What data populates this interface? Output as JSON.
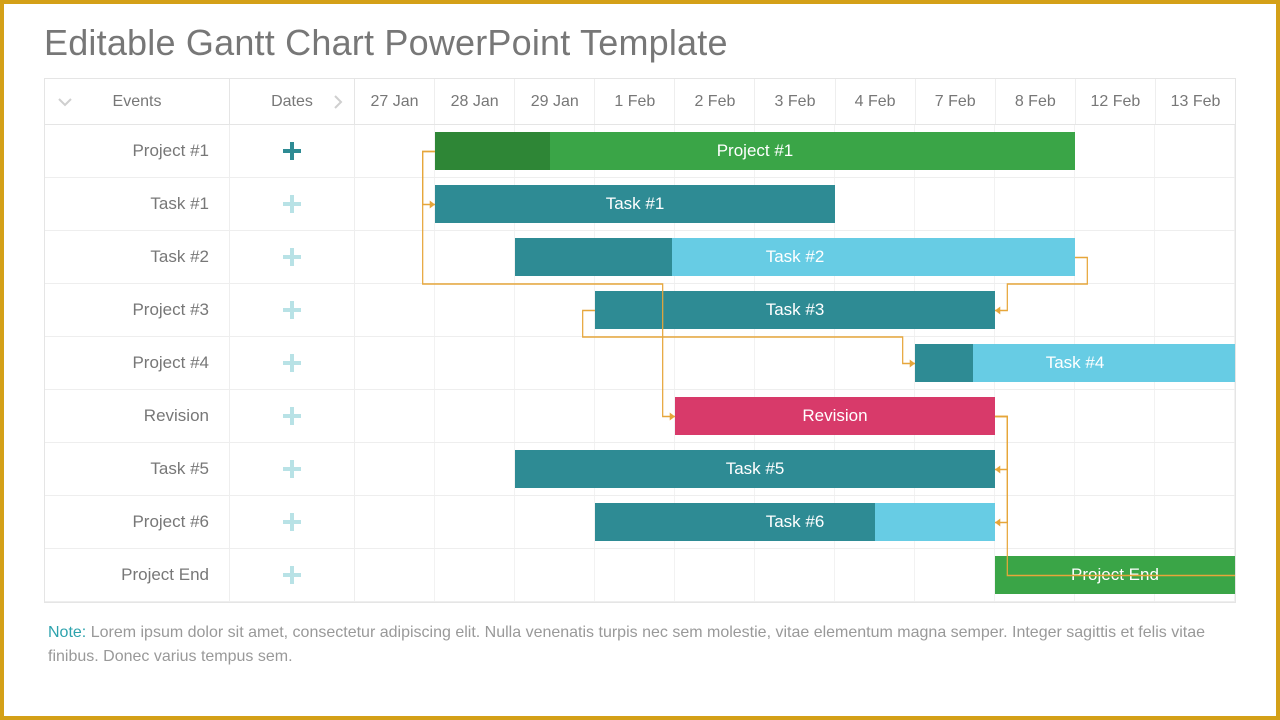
{
  "title": "Editable Gantt Chart PowerPoint Template",
  "header": {
    "events_label": "Events",
    "dates_label": "Dates",
    "dates": [
      "27 Jan",
      "28 Jan",
      "29 Jan",
      "1 Feb",
      "2 Feb",
      "3 Feb",
      "4 Feb",
      "7 Feb",
      "8 Feb",
      "12 Feb",
      "13 Feb"
    ]
  },
  "rows": [
    {
      "event": "Project #1",
      "plus": "teal",
      "bar": {
        "label": "Project #1",
        "start": 1,
        "span": 8,
        "fill": "#3aa547",
        "progFill": "#2e8636",
        "progPct": 0.18
      }
    },
    {
      "event": "Task #1",
      "plus": "light",
      "bar": {
        "label": "Task #1",
        "start": 1,
        "span": 5,
        "fill": "#2e8b94"
      }
    },
    {
      "event": "Task #2",
      "plus": "light",
      "bar": {
        "label": "Task #2",
        "start": 2,
        "span": 7,
        "fill": "#67cce4",
        "progFill": "#2e8b94",
        "progPct": 0.28
      }
    },
    {
      "event": "Project #3",
      "plus": "light",
      "bar": {
        "label": "Task #3",
        "start": 3,
        "span": 5,
        "fill": "#2e8b94"
      }
    },
    {
      "event": "Project #4",
      "plus": "light",
      "bar": {
        "label": "Task #4",
        "start": 7,
        "span": 4,
        "fill": "#67cce4",
        "progFill": "#2e8b94",
        "progPct": 0.18
      }
    },
    {
      "event": "Revision",
      "plus": "light",
      "bar": {
        "label": "Revision",
        "start": 4,
        "span": 4,
        "fill": "#d83a6a"
      }
    },
    {
      "event": "Task #5",
      "plus": "light",
      "bar": {
        "label": "Task #5",
        "start": 2,
        "span": 6,
        "fill": "#2e8b94"
      }
    },
    {
      "event": "Project #6",
      "plus": "light",
      "bar": {
        "label": "Task #6",
        "start": 3,
        "span": 5,
        "fill": "#67cce4",
        "progFill": "#2e8b94",
        "progPct": 0.7
      }
    },
    {
      "event": "Project End",
      "plus": "light",
      "bar": {
        "label": "Project End",
        "start": 8,
        "span": 3,
        "fill": "#3aa547"
      }
    }
  ],
  "connectors": [
    {
      "from_row": 0,
      "from_side": "start",
      "to_row": 1,
      "to_side": "start"
    },
    {
      "from_row": 0,
      "from_side": "start",
      "to_row": 5,
      "to_side": "start"
    },
    {
      "from_row": 2,
      "from_side": "end",
      "to_row": 3,
      "to_side": "end"
    },
    {
      "from_row": 3,
      "from_side": "start",
      "to_row": 4,
      "to_side": "start"
    },
    {
      "from_row": 5,
      "from_side": "end",
      "to_row": 6,
      "to_side": "end"
    },
    {
      "from_row": 5,
      "from_side": "end",
      "to_row": 7,
      "to_side": "end"
    },
    {
      "from_row": 5,
      "from_side": "end",
      "to_row": 8,
      "to_side": "end"
    }
  ],
  "note": {
    "label": "Note:",
    "text": "Lorem ipsum dolor sit amet, consectetur adipiscing elit. Nulla venenatis turpis nec sem molestie, vitae elementum magna semper. Integer sagittis et felis vitae finibus. Donec varius tempus sem."
  },
  "colors": {
    "connector": "#e6a63a"
  },
  "chart_data": {
    "type": "gantt",
    "title": "Editable Gantt Chart PowerPoint Template",
    "date_columns": [
      "27 Jan",
      "28 Jan",
      "29 Jan",
      "1 Feb",
      "2 Feb",
      "3 Feb",
      "4 Feb",
      "7 Feb",
      "8 Feb",
      "12 Feb",
      "13 Feb"
    ],
    "tasks": [
      {
        "name": "Project #1",
        "bar_label": "Project #1",
        "start": "28 Jan",
        "end": "8 Feb",
        "progress": 0.18,
        "color": "#3aa547"
      },
      {
        "name": "Task #1",
        "bar_label": "Task #1",
        "start": "28 Jan",
        "end": "3 Feb",
        "progress": null,
        "color": "#2e8b94"
      },
      {
        "name": "Task #2",
        "bar_label": "Task #2",
        "start": "29 Jan",
        "end": "8 Feb",
        "progress": 0.28,
        "color": "#67cce4"
      },
      {
        "name": "Project #3",
        "bar_label": "Task #3",
        "start": "1 Feb",
        "end": "7 Feb",
        "progress": null,
        "color": "#2e8b94"
      },
      {
        "name": "Project #4",
        "bar_label": "Task #4",
        "start": "7 Feb",
        "end": "13 Feb",
        "progress": 0.18,
        "color": "#67cce4"
      },
      {
        "name": "Revision",
        "bar_label": "Revision",
        "start": "2 Feb",
        "end": "7 Feb",
        "progress": null,
        "color": "#d83a6a"
      },
      {
        "name": "Task #5",
        "bar_label": "Task #5",
        "start": "29 Jan",
        "end": "7 Feb",
        "progress": null,
        "color": "#2e8b94"
      },
      {
        "name": "Project #6",
        "bar_label": "Task #6",
        "start": "1 Feb",
        "end": "7 Feb",
        "progress": 0.7,
        "color": "#67cce4"
      },
      {
        "name": "Project End",
        "bar_label": "Project End",
        "start": "8 Feb",
        "end": "13 Feb",
        "progress": null,
        "color": "#3aa547"
      }
    ],
    "dependencies": [
      [
        "Project #1",
        "Task #1"
      ],
      [
        "Project #1",
        "Revision"
      ],
      [
        "Task #2",
        "Project #3"
      ],
      [
        "Project #3",
        "Project #4"
      ],
      [
        "Revision",
        "Task #5"
      ],
      [
        "Revision",
        "Project #6"
      ],
      [
        "Revision",
        "Project End"
      ]
    ]
  }
}
